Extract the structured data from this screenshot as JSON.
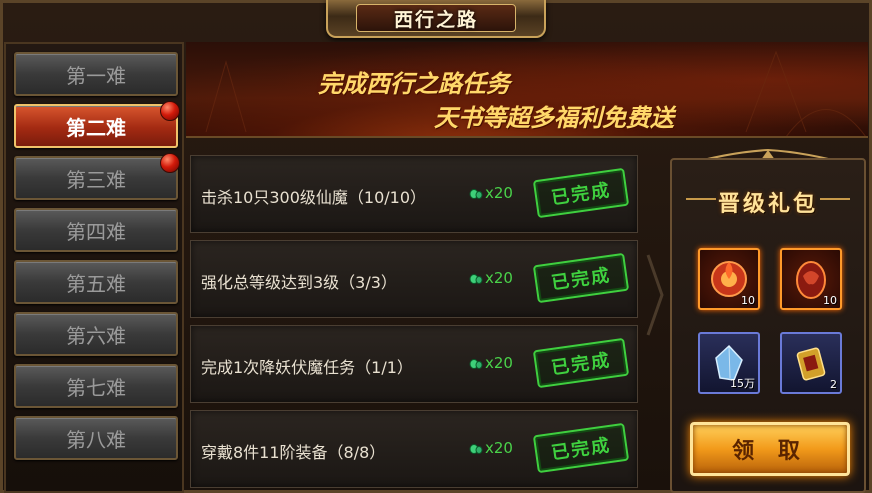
{
  "window": {
    "title": "西行之路"
  },
  "sidebar": {
    "items": [
      {
        "label": "第一难",
        "active": false,
        "badge": false
      },
      {
        "label": "第二难",
        "active": true,
        "badge": true
      },
      {
        "label": "第三难",
        "active": false,
        "badge": true
      },
      {
        "label": "第四难",
        "active": false,
        "badge": false
      },
      {
        "label": "第五难",
        "active": false,
        "badge": false
      },
      {
        "label": "第六难",
        "active": false,
        "badge": false
      },
      {
        "label": "第七难",
        "active": false,
        "badge": false
      },
      {
        "label": "第八难",
        "active": false,
        "badge": false
      }
    ]
  },
  "banner": {
    "line1": "完成西行之路任务",
    "line2": "天书等超多福利免费送"
  },
  "tasks": [
    {
      "text": "击杀10只300级仙魔（10/10）",
      "reward_icon": "jade-icon",
      "reward": "x20",
      "status": "已完成"
    },
    {
      "text": "强化总等级达到3级（3/3）",
      "reward_icon": "jade-icon",
      "reward": "x20",
      "status": "已完成"
    },
    {
      "text": "完成1次降妖伏魔任务（1/1）",
      "reward_icon": "jade-icon",
      "reward": "x20",
      "status": "已完成"
    },
    {
      "text": "穿戴8件11阶装备（8/8）",
      "reward_icon": "jade-icon",
      "reward": "x20",
      "status": "已完成"
    }
  ],
  "gift": {
    "title": "晋级礼包",
    "items": [
      {
        "icon": "fire-orb-icon",
        "qty": "10",
        "rarity": "orange"
      },
      {
        "icon": "dragon-egg-icon",
        "qty": "10",
        "rarity": "orange"
      },
      {
        "icon": "crystal-shard-icon",
        "qty": "15万",
        "rarity": "purple"
      },
      {
        "icon": "golden-token-icon",
        "qty": "2",
        "rarity": "purple"
      }
    ],
    "claim_label": "领 取"
  },
  "colors": {
    "accent_gold": "#ffd86a",
    "complete_green": "#3fd03f",
    "active_tab": "#a32a12"
  }
}
